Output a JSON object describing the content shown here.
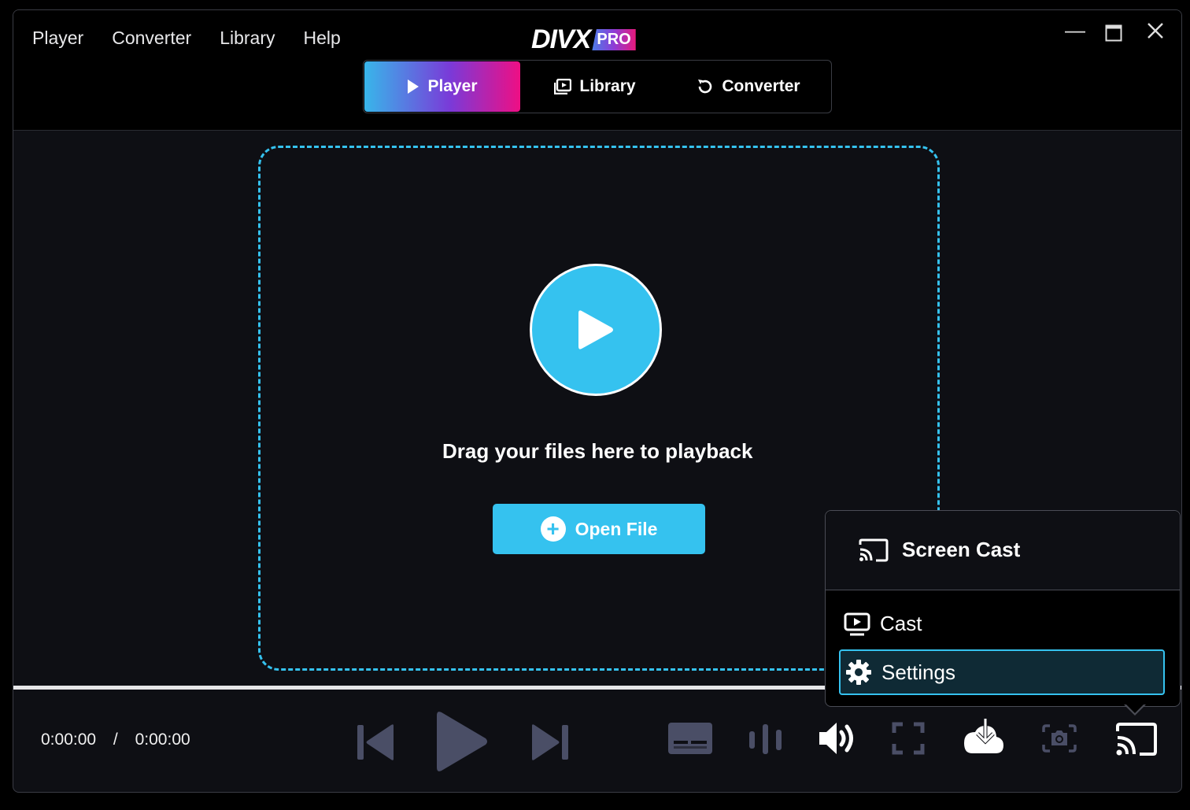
{
  "menu": {
    "player": "Player",
    "converter": "Converter",
    "library": "Library",
    "help": "Help"
  },
  "logo": {
    "name": "DIVX",
    "badge": "PRO"
  },
  "tabs": [
    {
      "label": "Player",
      "icon": "play-icon",
      "active": true
    },
    {
      "label": "Library",
      "icon": "library-icon",
      "active": false
    },
    {
      "label": "Converter",
      "icon": "refresh-icon",
      "active": false
    }
  ],
  "dropzone": {
    "text": "Drag your files here to playback",
    "open_label": "Open File"
  },
  "playback": {
    "current": "0:00:00",
    "separator": "/",
    "total": "0:00:00",
    "progress": 0
  },
  "cast_menu": {
    "title": "Screen Cast",
    "items": [
      {
        "label": "Cast",
        "icon": "tv-play-icon"
      },
      {
        "label": "Settings",
        "icon": "gear-icon",
        "selected": true
      }
    ]
  },
  "colors": {
    "accent": "#35c2ef",
    "disabled": "#4a4e66",
    "background": "#0e0f14"
  }
}
